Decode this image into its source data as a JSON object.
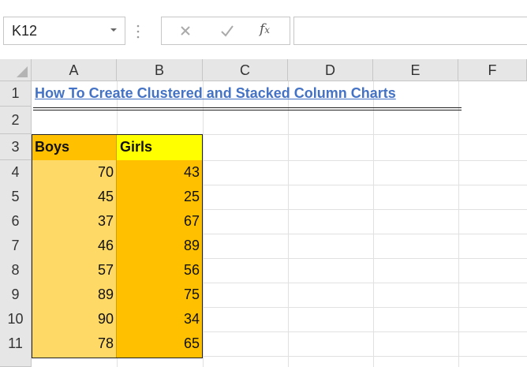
{
  "name_box": {
    "value": "K12"
  },
  "formula_bar": {
    "cancel_icon": "close-icon",
    "enter_icon": "check-icon",
    "fx_label": "fx",
    "value": ""
  },
  "columns": [
    "A",
    "B",
    "C",
    "D",
    "E",
    "F"
  ],
  "rows": [
    "1",
    "2",
    "3",
    "4",
    "5",
    "6",
    "7",
    "8",
    "9",
    "10",
    "11"
  ],
  "sheet": {
    "title": "How To Create Clustered and Stacked Column Charts",
    "headers": {
      "boys": "Boys",
      "girls": "Girls"
    },
    "boys": [
      "70",
      "45",
      "37",
      "46",
      "57",
      "89",
      "90",
      "78"
    ],
    "girls": [
      "43",
      "25",
      "67",
      "89",
      "56",
      "75",
      "34",
      "65"
    ]
  },
  "colors": {
    "title": "#4472c4",
    "boys_header_fill": "#ffc000",
    "girls_header_fill": "#ffff00",
    "boys_fill": "#ffd966",
    "girls_fill": "#ffc000"
  }
}
